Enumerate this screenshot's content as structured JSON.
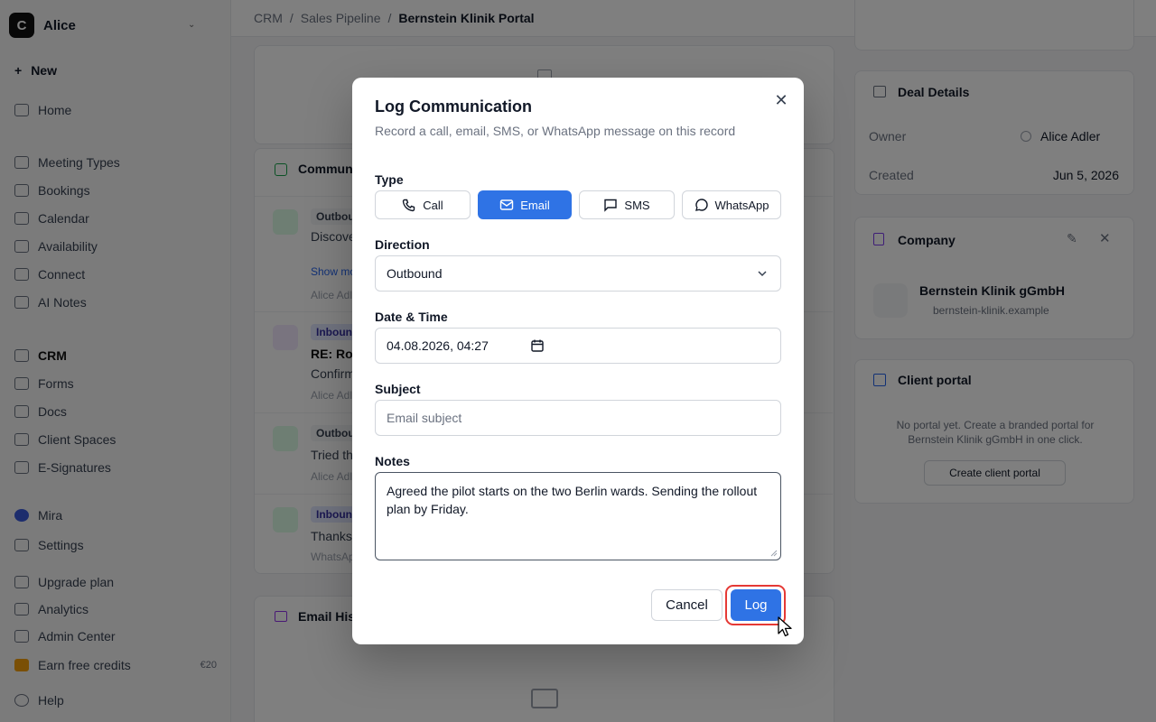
{
  "sidebar": {
    "workspace": "Alice",
    "new_label": "New",
    "items": [
      {
        "label": "Home"
      },
      {
        "label": "Meeting Types"
      },
      {
        "label": "Bookings"
      },
      {
        "label": "Calendar"
      },
      {
        "label": "Availability"
      },
      {
        "label": "Connect"
      },
      {
        "label": "AI Notes"
      },
      {
        "label": "CRM"
      },
      {
        "label": "Forms"
      },
      {
        "label": "Docs"
      },
      {
        "label": "Client Spaces"
      },
      {
        "label": "E-Signatures"
      },
      {
        "label": "Mira"
      },
      {
        "label": "Settings"
      },
      {
        "label": "Upgrade plan"
      },
      {
        "label": "Analytics"
      },
      {
        "label": "Admin Center"
      },
      {
        "label": "Earn free credits",
        "badge": "€20"
      },
      {
        "label": "Help"
      }
    ]
  },
  "breadcrumb": [
    "CRM",
    "Sales Pipeline",
    "Bernstein Klinik Portal"
  ],
  "background": {
    "communications_title": "Communications",
    "email_history_title": "Email History",
    "items": [
      {
        "badge": "Outbound",
        "text": "Discovery call covering the workflow needs",
        "show": "Show more",
        "meta": "Alice Adler"
      },
      {
        "badge": "Inbound",
        "text": "RE: Rollout",
        "sub": "Confirmed",
        "meta": "Alice Adler"
      },
      {
        "badge": "Outbound",
        "text": "Tried the main line",
        "meta": "Alice Adler"
      },
      {
        "badge": "Inbound",
        "text": "Thanks",
        "meta": "WhatsApp"
      }
    ],
    "deal_details": {
      "title": "Deal Details",
      "owner_label": "Owner",
      "owner": "Alice Adler",
      "created_label": "Created",
      "created": "Jun 5, 2026"
    },
    "company": {
      "title": "Company",
      "name": "Bernstein Klinik gGmbH",
      "domain": "bernstein-klinik.example"
    },
    "client_portal": {
      "title": "Client portal",
      "text": "No portal yet. Create a branded portal for Bernstein Klinik gGmbH in one click.",
      "button": "Create client portal"
    }
  },
  "modal": {
    "title": "Log Communication",
    "description": "Record a call, email, SMS, or WhatsApp message on this record",
    "type_label": "Type",
    "types": [
      {
        "label": "Call",
        "selected": false
      },
      {
        "label": "Email",
        "selected": true
      },
      {
        "label": "SMS",
        "selected": false
      },
      {
        "label": "WhatsApp",
        "selected": false
      }
    ],
    "direction_label": "Direction",
    "direction_value": "Outbound",
    "datetime_label": "Date & Time",
    "datetime_value": "04.08.2026, 04:27",
    "subject_label": "Subject",
    "subject_placeholder": "Email subject",
    "notes_label": "Notes",
    "notes_value": "Agreed the pilot starts on the two Berlin wards. Sending the rollout plan by Friday.",
    "cancel_label": "Cancel",
    "log_label": "Log"
  },
  "colors": {
    "accent": "#2f73e5",
    "highlight_ring": "#e53935",
    "overlay": "rgba(0,0,0,0.5)"
  }
}
